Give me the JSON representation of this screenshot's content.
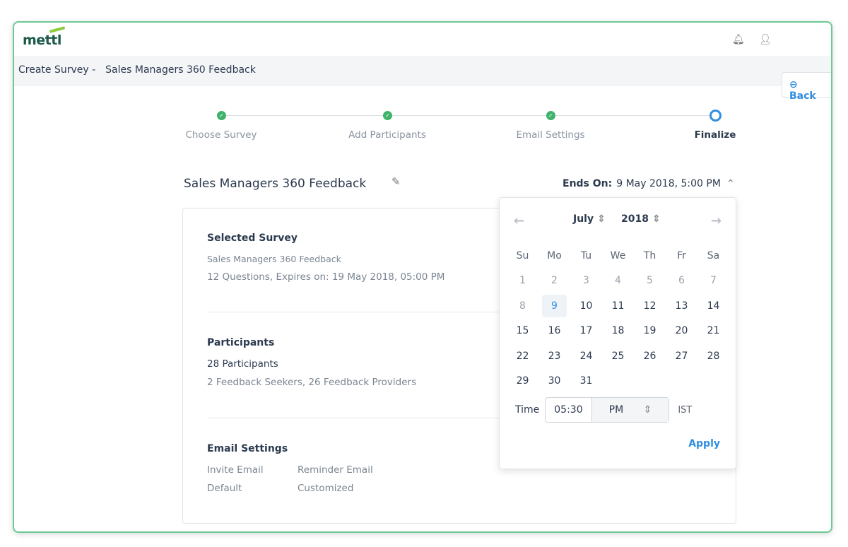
{
  "app": {
    "logo": "mettl"
  },
  "breadcrumb": {
    "root": "Create Survey -",
    "current": "Sales Managers 360 Feedback"
  },
  "back_label": "Back",
  "steps": [
    {
      "label": "Choose Survey",
      "done": true
    },
    {
      "label": "Add Participants",
      "done": true
    },
    {
      "label": "Email Settings",
      "done": true
    },
    {
      "label": "Finalize",
      "done": false
    }
  ],
  "survey_title": "Sales Managers 360 Feedback",
  "ends": {
    "label": "Ends On:",
    "value": "9 May 2018, 5:00 PM"
  },
  "selected_survey": {
    "heading": "Selected Survey",
    "name": "Sales Managers 360 Feedback",
    "detail": "12 Questions, Expires on: 19 May 2018, 05:00 PM"
  },
  "participants": {
    "heading": "Participants",
    "count": "28 Participants",
    "detail": "2 Feedback Seekers, 26 Feedback Providers"
  },
  "email_settings": {
    "heading": "Email Settings",
    "invite_label": "Invite Email",
    "invite_value": "Default",
    "reminder_label": "Reminder Email",
    "reminder_value": "Customized"
  },
  "calendar": {
    "month": "July",
    "year": "2018",
    "weekdays": [
      "Su",
      "Mo",
      "Tu",
      "We",
      "Th",
      "Fr",
      "Sa"
    ],
    "selected_day": 9,
    "first_enabled_day": 9,
    "days_in_month": 31,
    "start_weekday": 0,
    "time_label": "Time",
    "time": "05:30",
    "ampm": "PM",
    "tz": "IST",
    "apply": "Apply"
  }
}
